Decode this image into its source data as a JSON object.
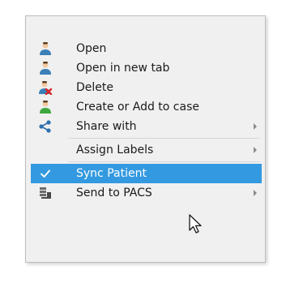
{
  "menu": {
    "items": [
      {
        "label": "Open",
        "icon": "person-icon",
        "submenu": false
      },
      {
        "label": "Open in new tab",
        "icon": "person-icon",
        "submenu": false
      },
      {
        "label": "Delete",
        "icon": "person-delete-icon",
        "submenu": false
      },
      {
        "label": "Create or Add to case",
        "icon": "person-add-icon",
        "submenu": false
      },
      {
        "label": "Share with",
        "icon": "share-icon",
        "submenu": true
      },
      {
        "label": "Assign Labels",
        "icon": "",
        "submenu": true
      },
      {
        "label": "Sync Patient",
        "icon": "checkmark-icon",
        "submenu": false,
        "highlighted": true,
        "checked": true
      },
      {
        "label": "Send to PACS",
        "icon": "pacs-server-icon",
        "submenu": true
      }
    ]
  },
  "colors": {
    "highlight": "#3399e0",
    "menu_background": "#f0f0f0",
    "person_body": "#3a7fb8",
    "person_head": "#f2c9a0",
    "delete_red": "#d9262a",
    "add_green": "#3ea83e"
  }
}
